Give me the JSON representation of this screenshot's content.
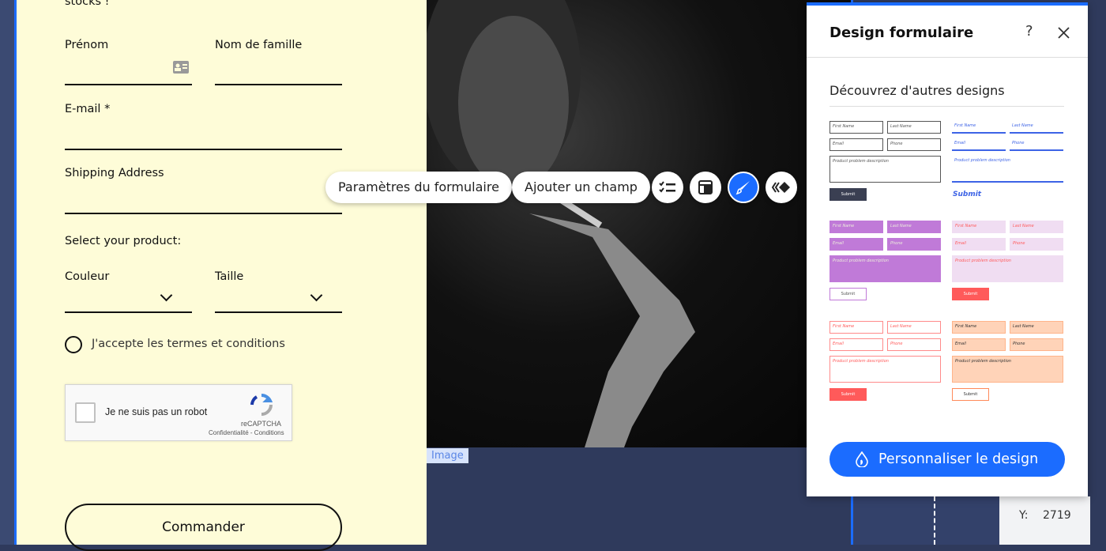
{
  "form": {
    "intro_text": "stocks !",
    "first_name_label": "Prénom",
    "last_name_label": "Nom de famille",
    "email_label": "E-mail *",
    "address_label": "Shipping Address",
    "product_label": "Select your product:",
    "color_label": "Couleur",
    "size_label": "Taille",
    "terms_label": "J'accepte les termes et conditions",
    "recaptcha": {
      "label": "Je ne suis pas un robot",
      "brand": "reCAPTCHA",
      "links": "Confidentialité - Conditions"
    },
    "submit_label": "Commander"
  },
  "image_tag": "Image",
  "toolbar": {
    "settings_label": "Paramètres du formulaire",
    "add_field_label": "Ajouter un champ",
    "icons": [
      "checklist-icon",
      "layout-icon",
      "brush-icon",
      "animation-icon"
    ]
  },
  "panel": {
    "title": "Design formulaire",
    "help": "?",
    "section_title": "Découvrez d'autres designs",
    "thumb_text": {
      "first": "First Name",
      "last": "Last Name",
      "email": "Email",
      "phone": "Phone",
      "desc": "Product problem description",
      "submit": "Submit"
    },
    "customize_label": "Personnaliser le design"
  },
  "coords": {
    "y_label": "Y:",
    "y_value": "2719"
  },
  "colors": {
    "accent": "#1b6cff",
    "form_bg": "#fefcd8"
  }
}
